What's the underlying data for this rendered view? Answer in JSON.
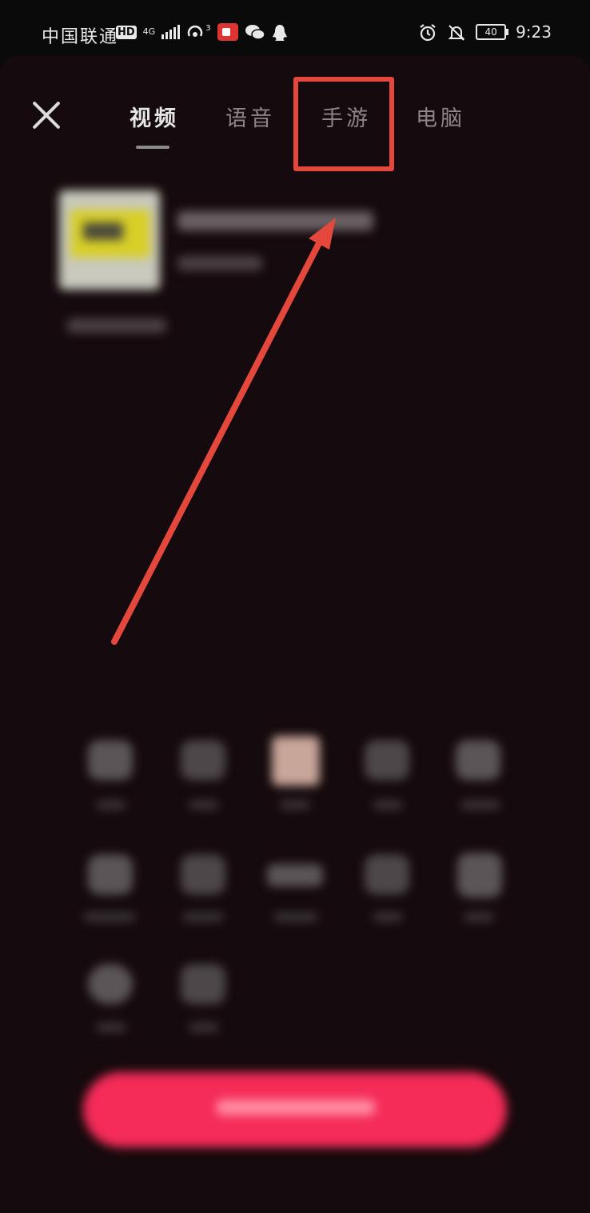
{
  "status_bar": {
    "carrier": "中国联通",
    "hd_badge": "HD",
    "network": "4G",
    "hotspot_badge": "3",
    "battery": "40",
    "time": "9:23"
  },
  "tabs": [
    {
      "label": "视频",
      "active": true
    },
    {
      "label": "语音",
      "active": false
    },
    {
      "label": "手游",
      "active": false
    },
    {
      "label": "电脑",
      "active": false
    }
  ],
  "colors": {
    "highlight": "#e4473c",
    "start_button": "#f52b58",
    "background": "#150a0d"
  },
  "icons": [
    "close-icon",
    "alarm-icon",
    "mute-bell-icon",
    "wechat-icon",
    "qq-icon",
    "hotspot-icon",
    "screen-record-icon"
  ]
}
